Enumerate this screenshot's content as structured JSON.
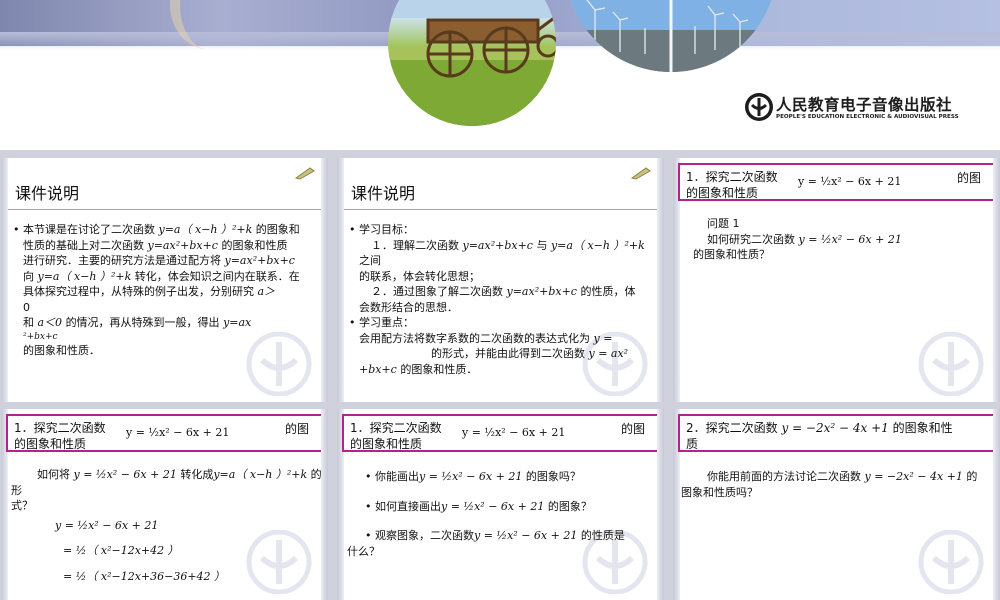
{
  "publisher": {
    "name_cn": "人民教育电子音像出版社",
    "name_en": "PEOPLE'S EDUCATION ELECTRONIC & AUDIOVISUAL PRESS"
  },
  "slides": [
    {
      "title": "课件说明",
      "lines": [
        "本节课是在讨论了二次函数",
        "y=a（ x−h ）²+k",
        "的图象和",
        "性质的基础上对二次函数",
        "y=ax²+bx+c",
        "的图象和性质",
        "进行研究．主要的研究方法是通过配方将",
        "y=ax²+bx+c",
        "向",
        "y=a（ x−h ）²+k",
        "转化，体会知识之间内在联系．在",
        "具体探究过程中，从特殊的例子出发，分别研究",
        "a＞",
        "0",
        "和",
        "a＜0",
        "的情况，再从特殊到一般，得出",
        "y=ax",
        "²+bx+c",
        "的图象和性质．"
      ]
    },
    {
      "title": "课件说明",
      "lines": [
        "学习目标：",
        "１．理解二次函数",
        "y=ax²+bx+c",
        "与",
        "y=a（ x−h ）²+k",
        "之间",
        "的联系，体会转化思想；",
        "２．通过图象了解二次函数",
        "y=ax²+bx+c",
        "的性质，体",
        "会数形结合的思想．",
        "学习重点：",
        "会用配方法将数字系数的二次函数的表达式化为",
        "y =",
        "的形式，并能由此得到二次函数",
        "y = ax²",
        "+bx+c",
        "的图象和性质．"
      ]
    },
    {
      "header": "1．探究二次函数",
      "header2": "的图象和性质",
      "formula": "y = ½x² − 6x + 21",
      "question_label": "问题 1",
      "question": "如何研究二次函数",
      "question_formula": "y = ½x² − 6x + 21",
      "question_end": "的图象和性质？"
    },
    {
      "header": "1．探究二次函数",
      "header2": "的图象和性质",
      "formula": "y = ½x² − 6x + 21",
      "line1a": "如何将",
      "line1b": "转化成",
      "line1c": "y=a（ x−h ）²+k",
      "line1d": "的",
      "line2": "形",
      "line3": "式？",
      "steps": [
        "y = ½x² − 6x + 21",
        "= ½（ x²−12x+42 ）",
        "= ½（ x²−12x+36−36+42 ）"
      ]
    },
    {
      "header": "1．探究二次函数",
      "header2": "的图象和性质",
      "formula": "y = ½x² − 6x + 21",
      "q1a": "你能画出",
      "q1b": "的图象吗？",
      "q2a": "如何直接画出",
      "q2b": "的图象？",
      "q3a": "观察图象，二次函数",
      "q3b": "的性质是",
      "q3c": "什么？"
    },
    {
      "header": "2．探究二次函数",
      "header_formula": "y = −2x² − 4x +1",
      "header_end": "的图象和性",
      "header2": "质",
      "body_a": "你能用前面的方法讨论二次函数",
      "body_formula": "y = −2x² − 4x +1",
      "body_b": "的",
      "body_c": "图象和性质吗？"
    }
  ]
}
